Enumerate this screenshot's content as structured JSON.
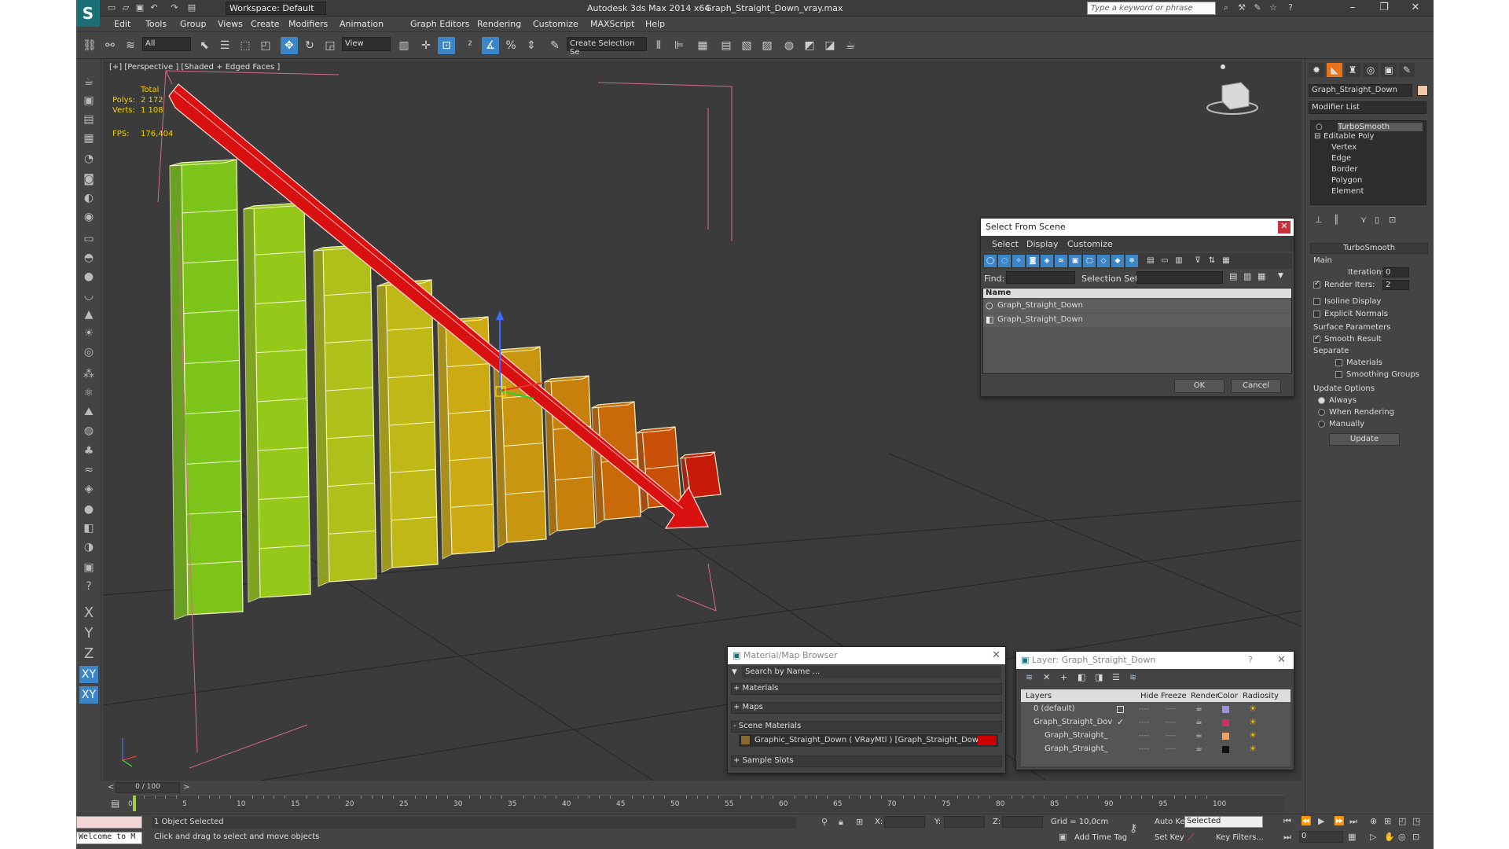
{
  "title_bar": {
    "app": "Autodesk 3ds Max  2014 x64",
    "file": "Graph_Straight_Down_vray.max",
    "workspace": "Workspace: Default",
    "search_placeholder": "Type a keyword or phrase"
  },
  "menu": [
    "Edit",
    "Tools",
    "Group",
    "Views",
    "Create",
    "Modifiers",
    "Animation",
    "Graph Editors",
    "Rendering",
    "Customize",
    "MAXScript",
    "Help"
  ],
  "toolbar": {
    "selection_filter": "All",
    "ref_coord": "View",
    "named_selection": "Create Selection Se"
  },
  "viewport": {
    "label": "[+] [Perspective ] [Shaded + Edged Faces ]",
    "stats": {
      "total_label": "Total",
      "polys_label": "Polys:",
      "polys": "2 172",
      "verts_label": "Verts:",
      "verts": "1 108",
      "fps_label": "FPS:",
      "fps": "176,404"
    }
  },
  "command_panel": {
    "object_name": "Graph_Straight_Down",
    "modifier_list": "Modifier List",
    "stack": [
      "TurboSmooth",
      "Editable Poly",
      "Vertex",
      "Edge",
      "Border",
      "Polygon",
      "Element"
    ],
    "turbosmooth": {
      "title": "TurboSmooth",
      "main": "Main",
      "iterations_label": "Iterations:",
      "iterations": "0",
      "render_iters_label": "Render Iters:",
      "render_iters": "2",
      "isoline": "Isoline Display",
      "explicit_normals": "Explicit Normals",
      "surface_params": "Surface Parameters",
      "smooth_result": "Smooth Result",
      "separate": "Separate",
      "materials": "Materials",
      "smoothing_groups": "Smoothing Groups",
      "update_options": "Update Options",
      "always": "Always",
      "when_rendering": "When Rendering",
      "manually": "Manually",
      "update": "Update"
    }
  },
  "select_dialog": {
    "title": "Select From Scene",
    "menus": [
      "Select",
      "Display",
      "Customize"
    ],
    "find_label": "Find:",
    "selection_set_label": "Selection Set:",
    "column": "Name",
    "items": [
      "Graph_Straight_Down",
      "Graph_Straight_Down"
    ],
    "ok": "OK",
    "cancel": "Cancel"
  },
  "material_browser": {
    "title": "Material/Map Browser",
    "search": "Search by Name ...",
    "sections": [
      "+ Materials",
      "+ Maps",
      "- Scene Materials",
      "+ Sample Slots"
    ],
    "scene_material": "Graphic_Straight_Down  ( VRayMtl )  [Graph_Straight_Down]"
  },
  "layer_dialog": {
    "title": "Layer: Graph_Straight_Down",
    "help": "?",
    "columns": [
      "Layers",
      "Hide",
      "Freeze",
      "Render",
      "Color",
      "Radiosity"
    ],
    "rows": [
      "0 (default)",
      "Graph_Straight_Dov",
      "Graph_Straight_",
      "Graph_Straight_"
    ]
  },
  "timeline": {
    "frame": "0 / 100",
    "ticks": [
      "0",
      "5",
      "10",
      "15",
      "20",
      "25",
      "30",
      "35",
      "40",
      "45",
      "50",
      "55",
      "60",
      "65",
      "70",
      "75",
      "80",
      "85",
      "90",
      "95",
      "100"
    ]
  },
  "status": {
    "welcome": "Welcome to M",
    "selected": "1 Object Selected",
    "prompt": "Click and drag to select and move objects",
    "x_label": "X:",
    "y_label": "Y:",
    "z_label": "Z:",
    "grid": "Grid = 10,0cm",
    "auto_key": "Auto Key",
    "set_key": "Set Key",
    "selected_mode": "Selected",
    "key_filters": "Key Filters...",
    "add_time_tag": "Add Time Tag",
    "frame_field": "0"
  },
  "colors": {
    "accent": "#3c86c8",
    "active_tab": "#e8731a",
    "material_swatch": "#cc0000"
  }
}
